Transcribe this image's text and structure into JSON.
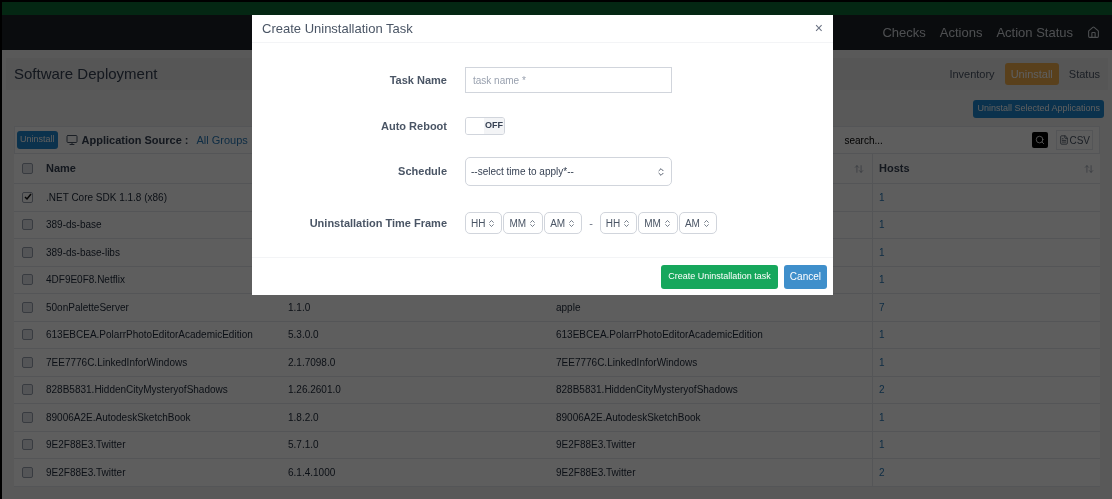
{
  "navbar": {
    "links": [
      "Checks",
      "Actions",
      "Action Status"
    ]
  },
  "page": {
    "title": "Software Deployment",
    "tabs": [
      {
        "label": "Inventory",
        "selected": false
      },
      {
        "label": "Uninstall",
        "selected": true
      },
      {
        "label": "Status",
        "selected": false
      }
    ]
  },
  "uninstall_selected_button": "Uninstall Selected Applications",
  "toolbar": {
    "uninstall_button": "Uninstall",
    "source_label": "Application Source :",
    "source_value": "All Groups",
    "search": {
      "placeholder": "search..."
    },
    "csv_button": "CSV"
  },
  "table": {
    "select_all_checked": false,
    "name_header": "Name",
    "hosts_header": "Hosts",
    "rows": [
      {
        "checked": true,
        "name": ".NET Core SDK 1.1.8 (x86)",
        "hosts": "1"
      },
      {
        "checked": false,
        "name": "389-ds-base",
        "hosts": "1"
      },
      {
        "checked": false,
        "name": "389-ds-base-libs",
        "hosts": "1"
      },
      {
        "checked": false,
        "name": "4DF9E0F8.Netflix",
        "hosts": "1"
      },
      {
        "checked": false,
        "name": "50onPaletteServer",
        "version": "1.1.0",
        "publisher": "apple",
        "hosts": "7"
      },
      {
        "checked": false,
        "name": "613EBCEA.PolarrPhotoEditorAcademicEdition",
        "version": "5.3.0.0",
        "publisher": "613EBCEA.PolarrPhotoEditorAcademicEdition",
        "hosts": "1"
      },
      {
        "checked": false,
        "name": "7EE7776C.LinkedInforWindows",
        "version": "2.1.7098.0",
        "publisher": "7EE7776C.LinkedInforWindows",
        "hosts": "1"
      },
      {
        "checked": false,
        "name": "828B5831.HiddenCityMysteryofShadows",
        "version": "1.26.2601.0",
        "publisher": "828B5831.HiddenCityMysteryofShadows",
        "hosts": "2"
      },
      {
        "checked": false,
        "name": "89006A2E.AutodeskSketchBook",
        "version": "1.8.2.0",
        "publisher": "89006A2E.AutodeskSketchBook",
        "hosts": "1"
      },
      {
        "checked": false,
        "name": "9E2F88E3.Twitter",
        "version": "5.7.1.0",
        "publisher": "9E2F88E3.Twitter",
        "hosts": "1"
      },
      {
        "checked": false,
        "name": "9E2F88E3.Twitter",
        "version": "6.1.4.1000",
        "publisher": "9E2F88E3.Twitter",
        "hosts": "2"
      }
    ]
  },
  "modal": {
    "title": "Create Uninstallation Task",
    "close": "×",
    "task_name": {
      "label": "Task Name",
      "placeholder": "task name *"
    },
    "auto_reboot": {
      "label": "Auto Reboot",
      "on": false,
      "state_text": "OFF"
    },
    "schedule": {
      "label": "Schedule",
      "value": "--select time to apply*--"
    },
    "time_frame": {
      "label": "Uninstallation Time Frame",
      "start": [
        "HH",
        "MM",
        "AM"
      ],
      "separator": "-",
      "end": [
        "HH",
        "MM",
        "AM"
      ]
    },
    "create_button": "Create Uninstallation task",
    "cancel_button": "Cancel"
  }
}
